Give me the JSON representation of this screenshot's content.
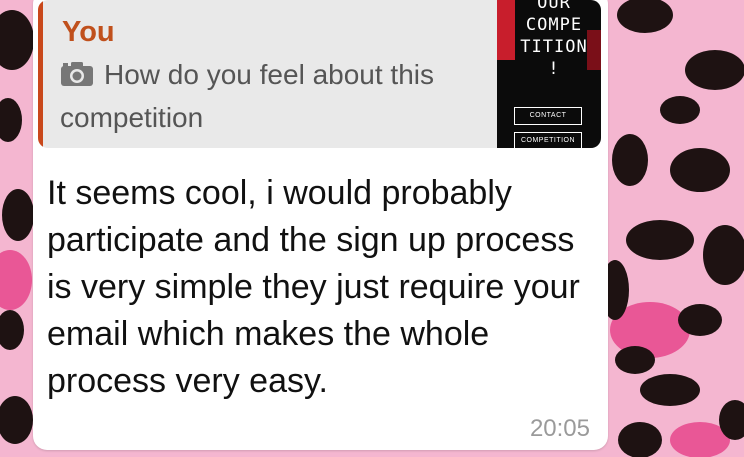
{
  "reply": {
    "author": "You",
    "camera_icon": "camera-icon",
    "text": "How do you feel about this competition"
  },
  "thumbnail": {
    "title_lines": [
      "OUR",
      "COMPE",
      "TITION",
      "!"
    ],
    "buttons": [
      "CONTACT",
      "COMPETITION"
    ]
  },
  "message": {
    "text": "It seems cool, i would probably participate and the sign up process is very simple they just require your email which makes the whole process very easy.",
    "time": "20:05"
  },
  "colors": {
    "author": "#c0501c",
    "quote_bar": "#c9481b",
    "wallpaper": "#f2a8c8",
    "spots": "#1e1212"
  }
}
